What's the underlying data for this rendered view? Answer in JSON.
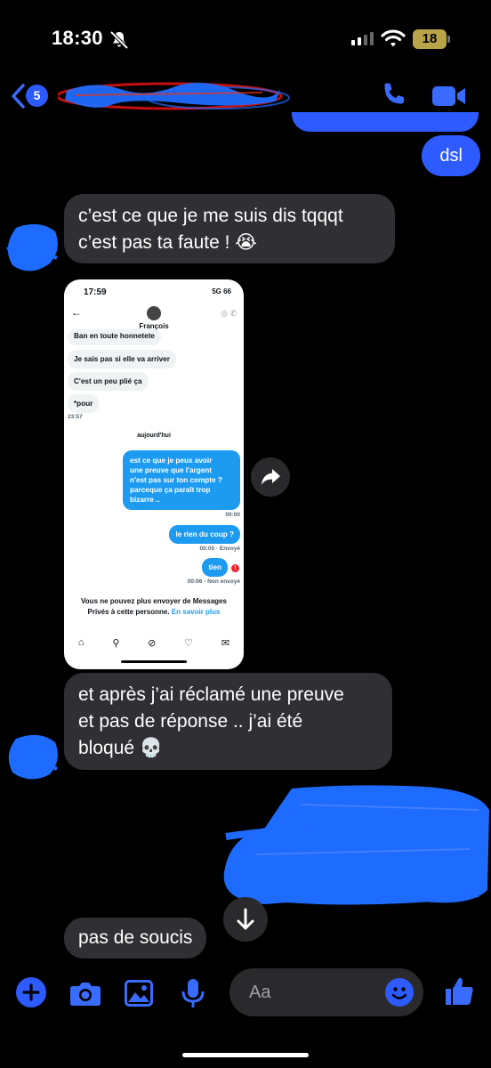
{
  "status_bar": {
    "time": "18:30",
    "battery": "18"
  },
  "header": {
    "unread_count": "5"
  },
  "messages": {
    "sent_1": "dsl",
    "recv_1_line1": "c’est ce que je me suis dis tqqqt",
    "recv_1_line2": "c’est pas ta faute ! 😭",
    "recv_2_line1": "et après j’ai réclamé une preuve",
    "recv_2_line2": "et pas de réponse .. j’ai été",
    "recv_2_line3": "bloqué 💀",
    "recv_3": "pas de soucis"
  },
  "screenshot": {
    "time": "17:59",
    "status": "5G 66",
    "contact_name": "François",
    "msg_partial": "Ban en toute honnetete",
    "msg_1": "Je sais pas si elle va arriver",
    "msg_2": "C'est un peu plié ça",
    "msg_3": "*pour",
    "time_1": "23:57",
    "day_separator": "aujourd'hui",
    "sent_1_l1": "est ce que je peux avoir",
    "sent_1_l2": "une preuve que l'argent",
    "sent_1_l3": "n'est pas sur ton compte ?",
    "sent_1_l4": "parceque ça paraît trop",
    "sent_1_l5": "bizarre ..",
    "time_2": "00:00",
    "sent_2": "le rien du coup ?",
    "time_3": "00:05 · Envoyé",
    "sent_3": "tien",
    "time_4": "00:06 · Non envoyé",
    "notice_l1": "Vous ne pouvez plus envoyer de Messages",
    "notice_l2": "Privés à cette personne.",
    "notice_link": "En savoir plus"
  },
  "composer": {
    "placeholder": "Aa"
  },
  "colors": {
    "accent": "#2d5bff",
    "bubble_recv": "#303034",
    "scribble": "#1e6bff"
  }
}
